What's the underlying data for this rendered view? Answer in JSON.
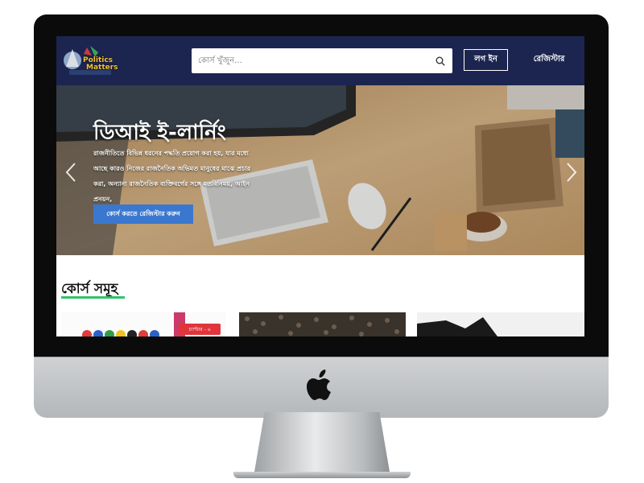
{
  "site": {
    "logo_text_line1": "Politics",
    "logo_text_line2": "Matters"
  },
  "header": {
    "search_placeholder": "কোর্স খুঁজুন...",
    "login_label": "লগ ইন",
    "register_label": "রেজিস্টার"
  },
  "hero": {
    "title": "ডিআই ই-লার্নিং",
    "description": "রাজনীতিতে বিভিন্ন ধরনের পদ্ধতি প্রয়োগ করা হয়, যার মধ্যে আছে কারও নিজের রাজনৈতিক অভিমত মানুষের মাঝে প্রচার করা, অন্যান্য রাজনৈতিক ব্যক্তিবর্গের সঙ্গে মতবিনিময়, আইন প্রনয়ন,",
    "cta_label": "কোর্স করতে রেজিস্টার করুন"
  },
  "courses": {
    "heading": "কোর্স সমূহ",
    "cards": [
      {
        "badge": "চ্যাপ্টার - ৬"
      },
      {
        "badge": ""
      },
      {
        "badge": ""
      }
    ]
  },
  "colors": {
    "navbar": "#1c2550",
    "cta": "#3a78d0",
    "accent_underline": "#2fc46b",
    "badge": "#e0353b"
  },
  "icons": [
    "search-icon",
    "chevron-left-icon",
    "chevron-right-icon",
    "apple-logo-icon"
  ]
}
